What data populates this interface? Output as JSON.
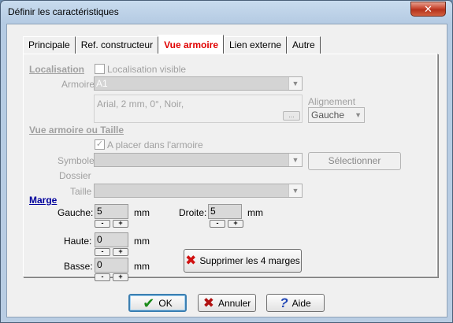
{
  "window": {
    "title": "Définir les caractéristiques",
    "close_glyph": "✕"
  },
  "tabs": [
    {
      "label": "Principale"
    },
    {
      "label": "Ref. constructeur"
    },
    {
      "label": "Vue armoire"
    },
    {
      "label": "Lien externe"
    },
    {
      "label": "Autre"
    }
  ],
  "localisation": {
    "section": "Localisation",
    "visible_label": "Localisation visible",
    "armoire_label": "Armoire",
    "armoire_value": "A1",
    "font_text": "Arial, 2 mm, 0°, Noir,",
    "dots_label": "...",
    "alignement_label": "Alignement",
    "alignement_value": "Gauche"
  },
  "vue": {
    "section": "Vue armoire ou Taille",
    "placer_label": "A placer dans l'armoire",
    "placer_check": "✓",
    "symbole_label": "Symbole",
    "dossier_label": "Dossier",
    "selectionner_label": "Sélectionner",
    "taille_label": "Taille"
  },
  "marge": {
    "section": "Marge",
    "gauche_label": "Gauche:",
    "gauche_value": "5",
    "droite_label": "Droite:",
    "droite_value": "5",
    "haute_label": "Haute:",
    "haute_value": "0",
    "basse_label": "Basse:",
    "basse_value": "0",
    "unit": "mm",
    "minus": "-",
    "plus": "+",
    "supprimer_label": "Supprimer les 4 marges"
  },
  "buttons": {
    "ok": "OK",
    "annuler": "Annuler",
    "aide": "Aide"
  },
  "colors": {
    "active_tab": "#e00000",
    "marge_link": "#00009c",
    "disabled_text": "#a0a0a0"
  }
}
